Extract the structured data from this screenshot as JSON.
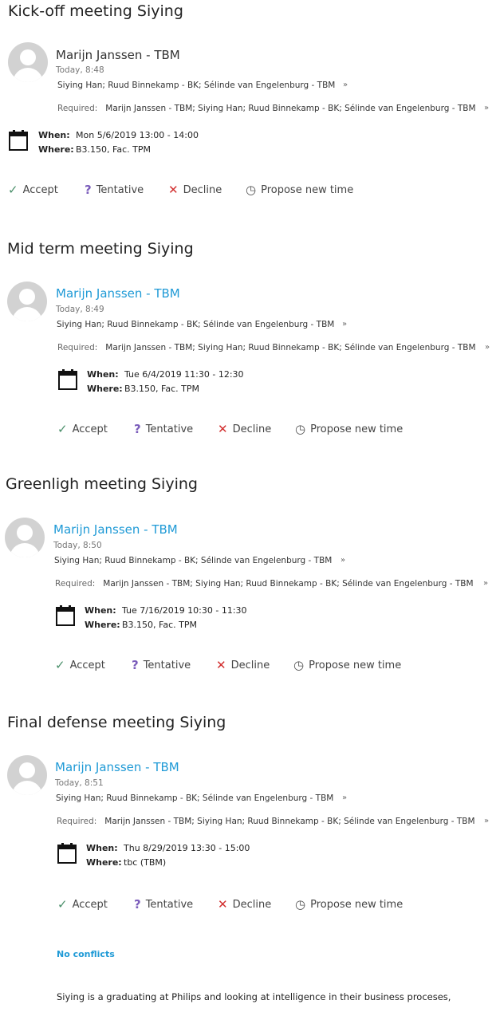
{
  "meetings": [
    {
      "title": "Kick-off meeting Siying",
      "sender": "Marijn Janssen - TBM",
      "time": "Today, 8:48",
      "recipients": "Siying Han; Ruud Binnekamp - BK; Sélinde van Engelenburg - TBM",
      "required_label": "Required:",
      "required": "Marijn Janssen - TBM; Siying Han; Ruud Binnekamp - BK; Sélinde van Engelenburg - TBM",
      "when_label": "When:",
      "when": "Mon 5/6/2019 13:00 - 14:00",
      "where_label": "Where:",
      "where": "B3.150, Fac. TPM",
      "accept": "Accept",
      "tentative": "Tentative",
      "decline": "Decline",
      "propose": "Propose new time"
    },
    {
      "title": "Mid term meeting Siying",
      "sender": "Marijn Janssen - TBM",
      "time": "Today, 8:49",
      "recipients": "Siying Han; Ruud Binnekamp - BK; Sélinde van Engelenburg - TBM",
      "required_label": "Required:",
      "required": "Marijn Janssen - TBM; Siying Han; Ruud Binnekamp - BK; Sélinde van Engelenburg - TBM",
      "when_label": "When:",
      "when": "Tue 6/4/2019 11:30 - 12:30",
      "where_label": "Where:",
      "where": "B3.150, Fac. TPM",
      "accept": "Accept",
      "tentative": "Tentative",
      "decline": "Decline",
      "propose": "Propose new time"
    },
    {
      "title": "Greenligh meeting Siying",
      "sender": "Marijn Janssen - TBM",
      "time": "Today, 8:50",
      "recipients": "Siying Han; Ruud Binnekamp - BK; Sélinde van Engelenburg - TBM",
      "required_label": "Required:",
      "required": "Marijn Janssen - TBM; Siying Han; Ruud Binnekamp - BK; Sélinde van Engelenburg - TBM",
      "when_label": "When:",
      "when": "Tue 7/16/2019 10:30 - 11:30",
      "where_label": "Where:",
      "where": "B3.150, Fac. TPM",
      "accept": "Accept",
      "tentative": "Tentative",
      "decline": "Decline",
      "propose": "Propose new time"
    },
    {
      "title": "Final defense meeting Siying",
      "sender": "Marijn Janssen - TBM",
      "time": "Today, 8:51",
      "recipients": "Siying Han; Ruud Binnekamp - BK; Sélinde van Engelenburg - TBM",
      "required_label": "Required:",
      "required": "Marijn Janssen - TBM; Siying Han; Ruud Binnekamp - BK; Sélinde van Engelenburg - TBM",
      "when_label": "When:",
      "when": "Thu 8/29/2019 13:30 - 15:00",
      "where_label": "Where:",
      "where": "tbc (TBM)",
      "accept": "Accept",
      "tentative": "Tentative",
      "decline": "Decline",
      "propose": "Propose new time"
    }
  ],
  "no_conflicts": "No conflicts",
  "body_text": "Siying is a graduating at Philips and looking at intelligence in their business proceses,",
  "colors": {
    "link_blue": "#1f9ad6",
    "accept_green": "#4a8f6a",
    "tentative_purple": "#7b5dbb",
    "decline_red": "#d23030"
  }
}
